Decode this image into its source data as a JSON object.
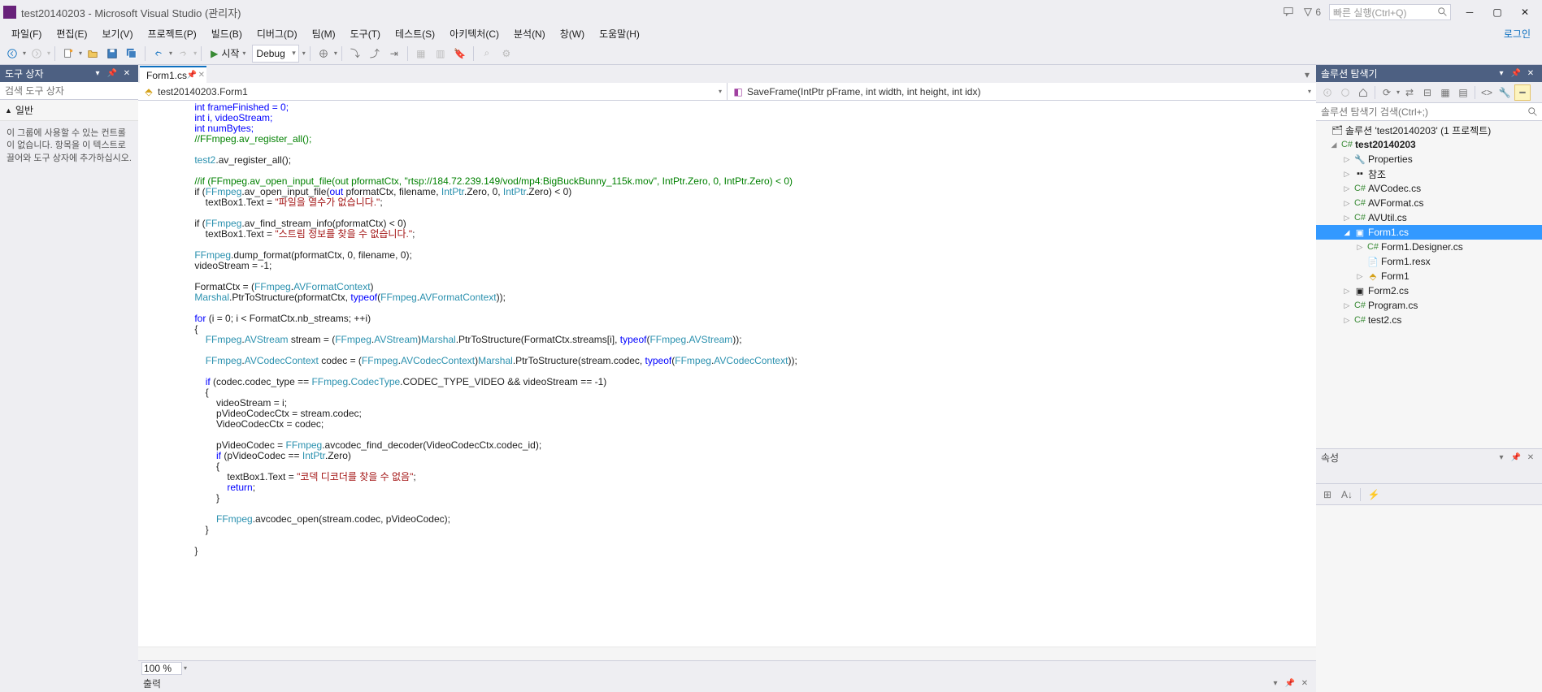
{
  "title": "test20140203 - Microsoft Visual Studio (관리자)",
  "notif_count": "6",
  "quick_launch_placeholder": "빠른 실행(Ctrl+Q)",
  "login": "로그인",
  "menu": [
    "파일(F)",
    "편집(E)",
    "보기(V)",
    "프로젝트(P)",
    "빌드(B)",
    "디버그(D)",
    "팀(M)",
    "도구(T)",
    "테스트(S)",
    "아키텍처(C)",
    "분석(N)",
    "창(W)",
    "도움말(H)"
  ],
  "start_label": "시작",
  "config_dropdown": "Debug",
  "toolbox": {
    "title": "도구 상자",
    "search_placeholder": "검색 도구 상자",
    "group": "일반",
    "message": "이 그룹에 사용할 수 있는 컨트롤이 없습니다. 항목을 이 텍스트로 끌어와 도구 상자에 추가하십시오."
  },
  "tab": {
    "label": "Form1.cs"
  },
  "breadcrumb": {
    "left": "test20140203.Form1",
    "right": "SaveFrame(IntPtr pFrame, int width, int height, int idx)"
  },
  "zoom": "100 %",
  "solution_explorer": {
    "title": "솔루션 탐색기",
    "search_placeholder": "솔루션 탐색기 검색(Ctrl+;)",
    "root": "솔루션 'test20140203' (1 프로젝트)",
    "project": "test20140203",
    "items": {
      "properties": "Properties",
      "references": "참조",
      "avcodec": "AVCodec.cs",
      "avformat": "AVFormat.cs",
      "avutil": "AVUtil.cs",
      "form1": "Form1.cs",
      "form1designer": "Form1.Designer.cs",
      "form1resx": "Form1.resx",
      "form1class": "Form1",
      "form2": "Form2.cs",
      "program": "Program.cs",
      "test2": "test2.cs"
    }
  },
  "properties": {
    "title": "속성"
  },
  "output": {
    "title": "출력"
  },
  "code": {
    "l1": "                int frameFinished = 0;",
    "l2": "                int i, videoStream;",
    "l3": "                int numBytes;",
    "l4": "                //FFmpeg.av_register_all();",
    "l5": "",
    "l6a": "                ",
    "l6b": "test2",
    "l6c": ".av_register_all();",
    "l7": "",
    "l8": "                //if (FFmpeg.av_open_input_file(out pformatCtx, \"rtsp://184.72.239.149/vod/mp4:BigBuckBunny_115k.mov\", IntPtr.Zero, 0, IntPtr.Zero) < 0)",
    "l9a": "                if (",
    "l9b": "FFmpeg",
    "l9c": ".av_open_input_file(",
    "l9d": "out",
    "l9e": " pformatCtx, filename, ",
    "l9f": "IntPtr",
    "l9g": ".Zero, 0, ",
    "l9h": "IntPtr",
    "l9i": ".Zero) < 0)",
    "l10a": "                    textBox1.Text = ",
    "l10b": "\"파일을 열수가 없습니다.\"",
    "l10c": ";",
    "l11": "",
    "l12a": "                if (",
    "l12b": "FFmpeg",
    "l12c": ".av_find_stream_info(pformatCtx) < 0)",
    "l13a": "                    textBox1.Text = ",
    "l13b": "\"스트림 정보를 찾을 수 없습니다.\"",
    "l13c": ";",
    "l14": "",
    "l15a": "                ",
    "l15b": "FFmpeg",
    "l15c": ".dump_format(pformatCtx, 0, filename, 0);",
    "l16": "                videoStream = -1;",
    "l17": "",
    "l18a": "                FormatCtx = (",
    "l18b": "FFmpeg",
    "l18c": ".",
    "l18d": "AVFormatContext",
    "l18e": ")",
    "l19a": "                ",
    "l19b": "Marshal",
    "l19c": ".PtrToStructure(pformatCtx, ",
    "l19d": "typeof",
    "l19e": "(",
    "l19f": "FFmpeg",
    "l19g": ".",
    "l19h": "AVFormatContext",
    "l19i": "));",
    "l20": "",
    "l21a": "                ",
    "l21b": "for",
    "l21c": " (i = 0; i < FormatCtx.nb_streams; ++i)",
    "l22": "                {",
    "l23a": "                    ",
    "l23b": "FFmpeg",
    "l23c": ".",
    "l23d": "AVStream",
    "l23e": " stream = (",
    "l23f": "FFmpeg",
    "l23g": ".",
    "l23h": "AVStream",
    "l23i": ")",
    "l23j": "Marshal",
    "l23k": ".PtrToStructure(FormatCtx.streams[i], ",
    "l23l": "typeof",
    "l23m": "(",
    "l23n": "FFmpeg",
    "l23o": ".",
    "l23p": "AVStream",
    "l23q": "));",
    "l24": "",
    "l25a": "                    ",
    "l25b": "FFmpeg",
    "l25c": ".",
    "l25d": "AVCodecContext",
    "l25e": " codec = (",
    "l25f": "FFmpeg",
    "l25g": ".",
    "l25h": "AVCodecContext",
    "l25i": ")",
    "l25j": "Marshal",
    "l25k": ".PtrToStructure(stream.codec, ",
    "l25l": "typeof",
    "l25m": "(",
    "l25n": "FFmpeg",
    "l25o": ".",
    "l25p": "AVCodecContext",
    "l25q": "));",
    "l26": "",
    "l27a": "                    ",
    "l27b": "if",
    "l27c": " (codec.codec_type == ",
    "l27d": "FFmpeg",
    "l27e": ".",
    "l27f": "CodecType",
    "l27g": ".CODEC_TYPE_VIDEO && videoStream == -1)",
    "l28": "                    {",
    "l29": "                        videoStream = i;",
    "l30": "                        pVideoCodecCtx = stream.codec;",
    "l31": "                        VideoCodecCtx = codec;",
    "l32": "",
    "l33a": "                        pVideoCodec = ",
    "l33b": "FFmpeg",
    "l33c": ".avcodec_find_decoder(VideoCodecCtx.codec_id);",
    "l34a": "                        ",
    "l34b": "if",
    "l34c": " (pVideoCodec == ",
    "l34d": "IntPtr",
    "l34e": ".Zero)",
    "l35": "                        {",
    "l36a": "                            textBox1.Text = ",
    "l36b": "\"코덱 디코더를 찾을 수 없음\"",
    "l36c": ";",
    "l37a": "                            ",
    "l37b": "return",
    "l37c": ";",
    "l38": "                        }",
    "l39": "",
    "l40a": "                        ",
    "l40b": "FFmpeg",
    "l40c": ".avcodec_open(stream.codec, pVideoCodec);",
    "l41": "                    }",
    "l42": "",
    "l43": "                }"
  }
}
